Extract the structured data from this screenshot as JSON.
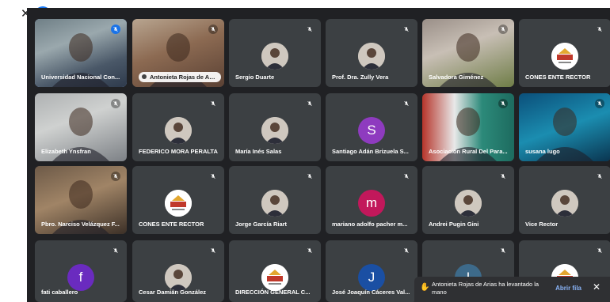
{
  "window": {
    "close_glyph": "✕",
    "facebook_glyph": "f"
  },
  "tiles": [
    {
      "name": "Universidad Nacional Con...",
      "kind": "video",
      "speaking": true,
      "video_icon": "person-at-desk-icon"
    },
    {
      "name": "Antonieta Rojas de Arias",
      "kind": "video",
      "pill": true,
      "video_icon": "woman-with-glasses-icon"
    },
    {
      "name": "Sergio Duarte",
      "kind": "avatar",
      "avatar_icon": "profile-photo-icon"
    },
    {
      "name": "Prof. Dra. Zully Vera",
      "kind": "avatar",
      "avatar_icon": "profile-photo-icon"
    },
    {
      "name": "Salvadora Giménez",
      "kind": "video",
      "video_icon": "woman-portrait-icon"
    },
    {
      "name": "CONES ENTE RECTOR",
      "kind": "logo",
      "logo_text": "CONES"
    },
    {
      "name": "Elizabeth Ynsfran",
      "kind": "video",
      "video_icon": "woman-portrait-icon"
    },
    {
      "name": "FEDERICO MORA PERALTA",
      "kind": "avatar",
      "avatar_icon": "shield-logo-icon"
    },
    {
      "name": "María Inés Salas",
      "kind": "avatar",
      "avatar_icon": "profile-photo-icon"
    },
    {
      "name": "Santiago Adán Brizuela S...",
      "kind": "letter",
      "letter": "S",
      "color": "#8e3bbf"
    },
    {
      "name": "Asociación Rural Del Para...",
      "kind": "video",
      "video_icon": "man-with-flags-icon"
    },
    {
      "name": "susana lugo",
      "kind": "video",
      "video_icon": "man-underwater-background-icon"
    },
    {
      "name": "Pbro. Narciso Velázquez F...",
      "kind": "video",
      "video_icon": "man-portrait-icon"
    },
    {
      "name": "CONES ENTE RECTOR",
      "kind": "logo",
      "logo_text": "CONES"
    },
    {
      "name": "Jorge García Riart",
      "kind": "avatar",
      "avatar_icon": "profile-photo-icon"
    },
    {
      "name": "mariano adolfo pacher m...",
      "kind": "letter",
      "letter": "m",
      "color": "#c2185b"
    },
    {
      "name": "Andrei Pugin Gini",
      "kind": "avatar",
      "avatar_icon": "profile-photo-icon"
    },
    {
      "name": "Vice Rector",
      "kind": "avatar",
      "avatar_icon": "profile-photo-icon"
    },
    {
      "name": "fati caballero",
      "kind": "letter",
      "letter": "f",
      "color": "#6a2bbf"
    },
    {
      "name": "Cesar Damián González",
      "kind": "avatar",
      "avatar_icon": "institution-logo-icon"
    },
    {
      "name": "DIRECCIÓN GENERAL C...",
      "kind": "logo",
      "logo_text": "CONES"
    },
    {
      "name": "José Joaquín Cáceres Val...",
      "kind": "letter",
      "letter": "J",
      "color": "#1a4fa3"
    },
    {
      "name": "",
      "kind": "letter",
      "letter": "I",
      "color": "#3d6a8a"
    },
    {
      "name": "",
      "kind": "logo",
      "logo_text": "CONES"
    }
  ],
  "toast": {
    "text": "Antonieta Rojas de Arias ha levantado la mano",
    "action": "Abrir fila",
    "dismiss": "✕",
    "icon": "raised-hand-icon"
  }
}
